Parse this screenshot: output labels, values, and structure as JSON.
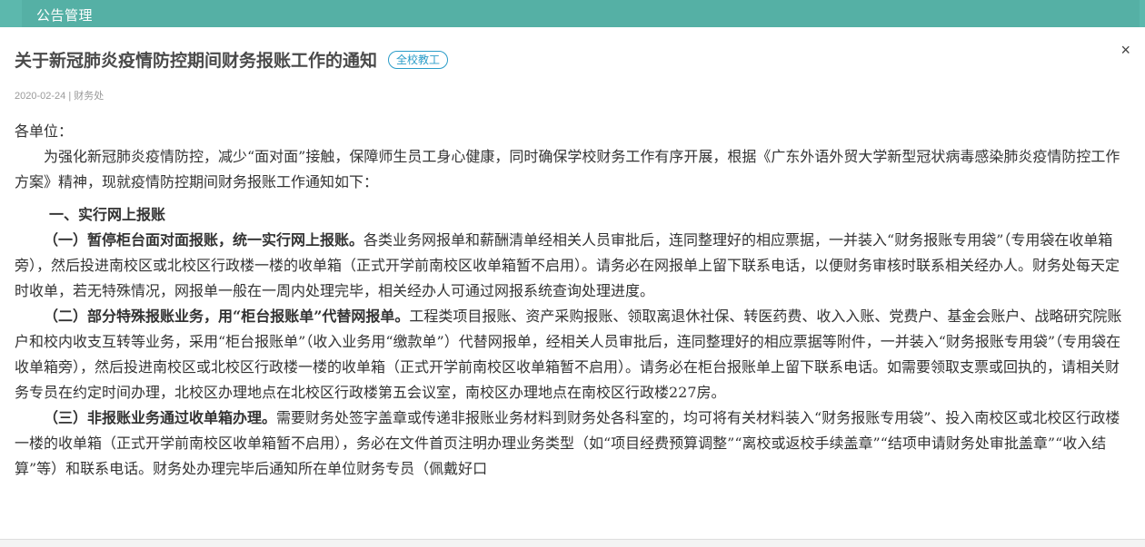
{
  "window": {
    "title": "公告管理"
  },
  "notice": {
    "title": "关于新冠肺炎疫情防控期间财务报账工作的通知",
    "badge": "全校教工",
    "date": "2020-02-24",
    "separator": "|",
    "department": "财务处",
    "close_label": "×"
  },
  "body": {
    "salutation": "各单位：",
    "intro": "为强化新冠肺炎疫情防控，减少“面对面”接触，保障师生员工身心健康，同时确保学校财务工作有序开展，根据《广东外语外贸大学新型冠状病毒感染肺炎疫情防控工作方案》精神，现就疫情防控期间财务报账工作通知如下：",
    "section1_heading": "一、实行网上报账",
    "p1_bold": "（一）暂停柜台面对面报账，统一实行网上报账。",
    "p1_text": "各类业务网报单和薪酬清单经相关人员审批后，连同整理好的相应票据，一并装入“财务报账专用袋”（专用袋在收单箱旁），然后投进南校区或北校区行政楼一楼的收单箱（正式开学前南校区收单箱暂不启用）。请务必在网报单上留下联系电话，以便财务审核时联系相关经办人。财务处每天定时收单，若无特殊情况，网报单一般在一周内处理完毕，相关经办人可通过网报系统查询处理进度。",
    "p2_bold": "（二）部分特殊报账业务，用“柜台报账单”代替网报单。",
    "p2_text": "工程类项目报账、资产采购报账、领取离退休社保、转医药费、收入入账、党费户、基金会账户、战略研究院账户和校内收支互转等业务，采用“柜台报账单”（收入业务用“缴款单”）代替网报单，经相关人员审批后，连同整理好的相应票据等附件，一并装入“财务报账专用袋”（专用袋在收单箱旁），然后投进南校区或北校区行政楼一楼的收单箱（正式开学前南校区收单箱暂不启用）。请务必在柜台报账单上留下联系电话。如需要领取支票或回执的，请相关财务专员在约定时间办理，北校区办理地点在北校区行政楼第五会议室，南校区办理地点在南校区行政楼227房。",
    "p3_bold": "（三）非报账业务通过收单箱办理。",
    "p3_text": "需要财务处签字盖章或传递非报账业务材料到财务处各科室的，均可将有关材料装入“财务报账专用袋”、投入南校区或北校区行政楼一楼的收单箱（正式开学前南校区收单箱暂不启用），务必在文件首页注明办理业务类型（如“项目经费预算调整”“离校或返校手续盖章”“结项申请财务处审批盖章”“收入结算”等）和联系电话。财务处办理完毕后通知所在单位财务专员（佩戴好口"
  }
}
